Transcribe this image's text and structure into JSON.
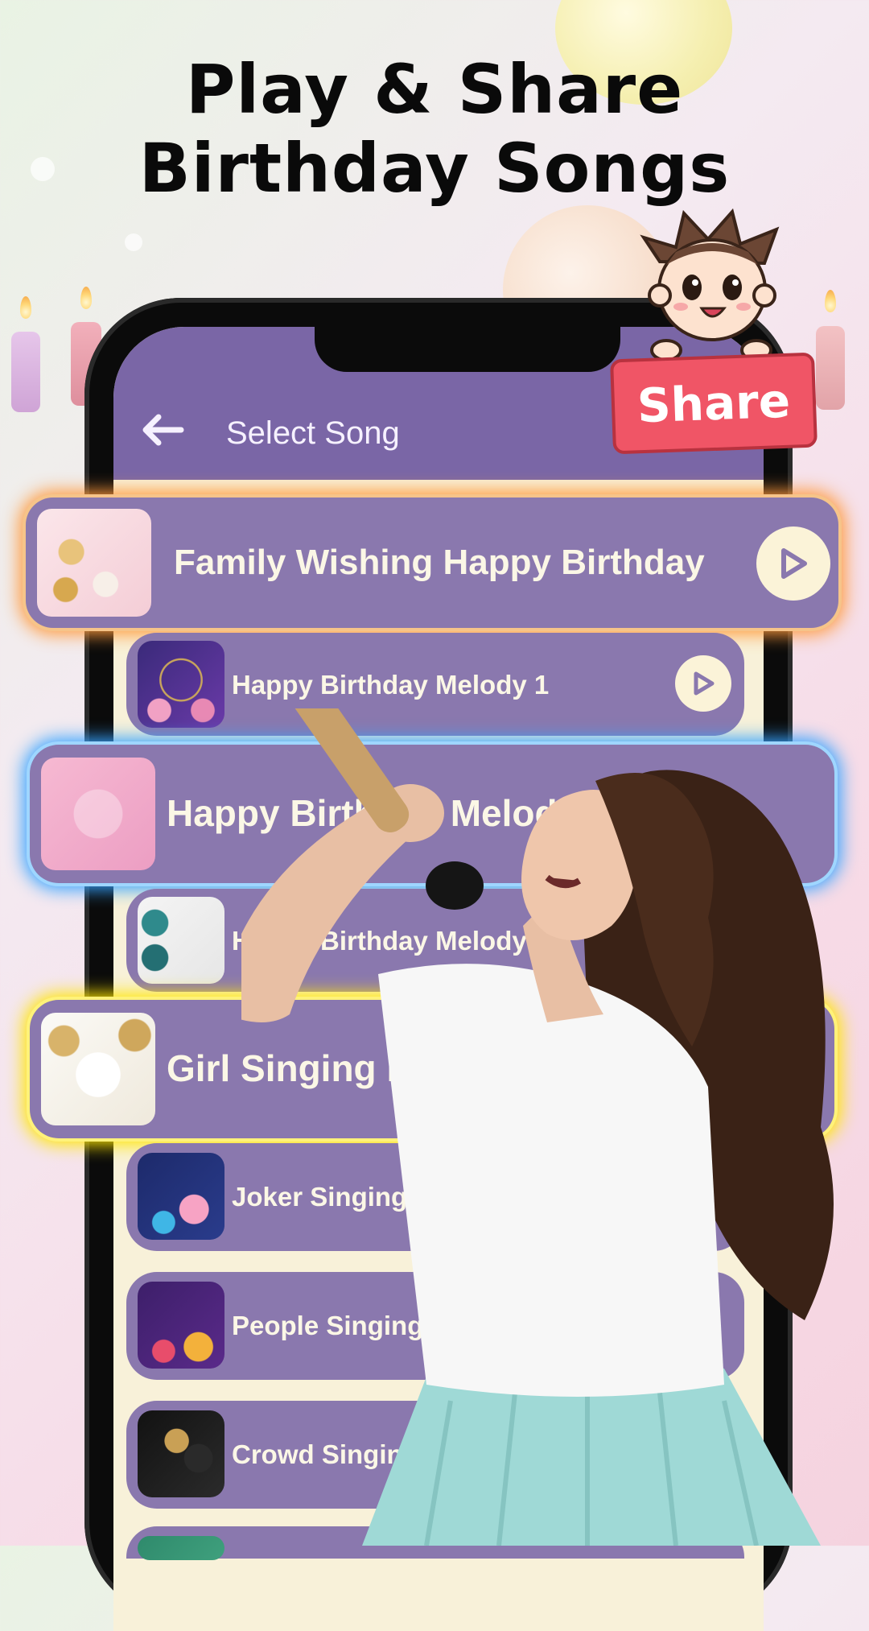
{
  "promo": {
    "headline_line1": "Play & Share",
    "headline_line2": "Birthday Songs",
    "share_badge": "Share"
  },
  "app": {
    "header": {
      "title": "Select Song",
      "back_icon": "arrow-left-icon"
    },
    "songs": [
      {
        "title": "Family Wishing Happy Birthday",
        "highlight": "orange",
        "play_icon": "play-icon"
      },
      {
        "title": "Happy Birthday Melody 1",
        "highlight": "none",
        "play_icon": "play-icon"
      },
      {
        "title": "Happy Birthday Melody 2",
        "highlight": "blue"
      },
      {
        "title": "Happy Birthday Melody 3",
        "highlight": "none"
      },
      {
        "title": "Girl Singing Happy Birthday",
        "highlight": "yellow"
      },
      {
        "title": "Joker Singing Happy Birthday",
        "highlight": "none"
      },
      {
        "title": "People Singing Happy Birthday",
        "highlight": "none"
      },
      {
        "title": "Crowd Singing Happy Birthday",
        "highlight": "none"
      }
    ]
  },
  "colors": {
    "header_bg": "#7a66a6",
    "row_bg": "#8a78ae",
    "list_bg": "#f8f1d9",
    "share_red": "#f05566"
  }
}
